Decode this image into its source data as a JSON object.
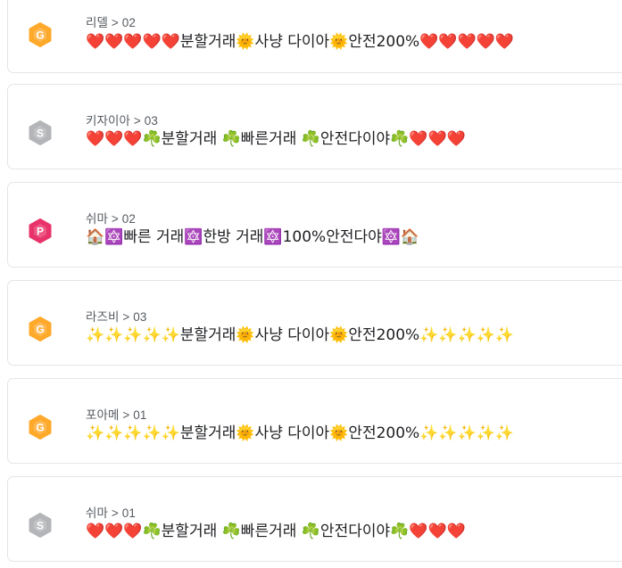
{
  "listings": [
    {
      "badge": {
        "letter": "G",
        "color": "#ffa92b",
        "icon": "gold-hexagon-icon"
      },
      "server": "리델 > 02",
      "title": "❤️❤️❤️❤️❤️분할거래🌞사냥 다이아🌞안전200%❤️❤️❤️❤️❤️"
    },
    {
      "badge": {
        "letter": "S",
        "color": "#b3b5b8",
        "icon": "silver-hexagon-icon"
      },
      "server": "키자이아 > 03",
      "title": "❤️❤️❤️☘️분할거래 ☘️빠른거래 ☘️안전다이야☘️❤️❤️❤️"
    },
    {
      "badge": {
        "letter": "P",
        "color": "#e8336a",
        "icon": "pink-hexagon-icon"
      },
      "server": "쉬마 > 02",
      "title": "🏠🔯빠른 거래🔯한방 거래🔯100%안전다야🔯🏠"
    },
    {
      "badge": {
        "letter": "G",
        "color": "#ffa92b",
        "icon": "gold-hexagon-icon"
      },
      "server": "라즈비 > 03",
      "title": "✨✨✨✨✨분할거래🌞사냥 다이아🌞안전200%✨✨✨✨✨"
    },
    {
      "badge": {
        "letter": "G",
        "color": "#ffa92b",
        "icon": "gold-hexagon-icon"
      },
      "server": "포아메 > 01",
      "title": "✨✨✨✨✨분할거래🌞사냥 다이아🌞안전200%✨✨✨✨✨"
    },
    {
      "badge": {
        "letter": "S",
        "color": "#b3b5b8",
        "icon": "silver-hexagon-icon"
      },
      "server": "쉬마 > 01",
      "title": "❤️❤️❤️☘️분할거래 ☘️빠른거래 ☘️안전다이야☘️❤️❤️❤️"
    }
  ]
}
